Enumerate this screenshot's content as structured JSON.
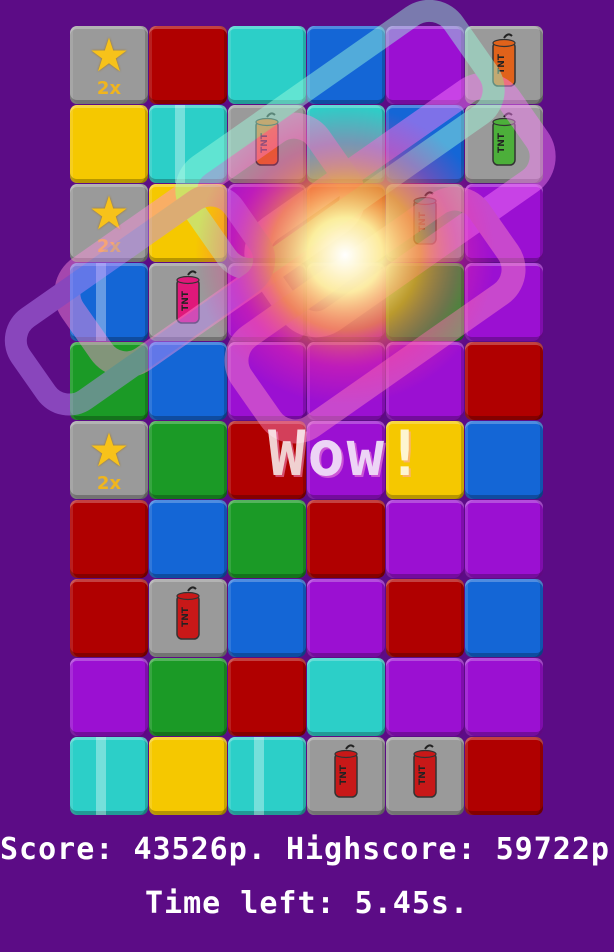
{
  "colors": {
    "background": "#5c0c86",
    "red": "#b00000",
    "cyan": "#2ccfc8",
    "blue": "#1466d6",
    "purple": "#9b10d2",
    "yellow": "#f5c800",
    "green": "#1b9a26",
    "gray": "#9a9a9a",
    "star": "#f7c21a"
  },
  "board": {
    "columns": 6,
    "rows": 10,
    "cells": [
      [
        "star",
        "red",
        "cyan",
        "blue",
        "purple",
        "tnt-orange"
      ],
      [
        "yellow",
        "cyan-stripe",
        "tnt-orange",
        "cyan",
        "blue",
        "tnt-green"
      ],
      [
        "star",
        "yellow",
        "purple",
        "red",
        "tnt-teal",
        "purple"
      ],
      [
        "blue-stripe",
        "tnt-pink",
        "purple",
        "purple",
        "green",
        "purple"
      ],
      [
        "green",
        "blue",
        "purple",
        "purple",
        "purple",
        "red"
      ],
      [
        "star",
        "green",
        "red",
        "purple",
        "yellow",
        "blue"
      ],
      [
        "red",
        "blue",
        "green",
        "red",
        "purple",
        "purple"
      ],
      [
        "red",
        "tnt-red",
        "blue",
        "purple",
        "red",
        "blue"
      ],
      [
        "purple",
        "green",
        "red",
        "cyan",
        "purple",
        "purple"
      ],
      [
        "cyan-stripe",
        "yellow",
        "cyan-stripe",
        "tnt-red",
        "tnt-red",
        "red"
      ]
    ],
    "star_multiplier": "2x",
    "tnt_label": "TNT"
  },
  "combo_text": "Wow!",
  "hud": {
    "score_label": "Score:",
    "score_value": "43526p.",
    "highscore_label": "Highscore:",
    "highscore_value": "59722p.",
    "time_label": "Time left:",
    "time_value": "5.45s."
  },
  "icons": [
    "star-icon",
    "tnt-icon"
  ]
}
